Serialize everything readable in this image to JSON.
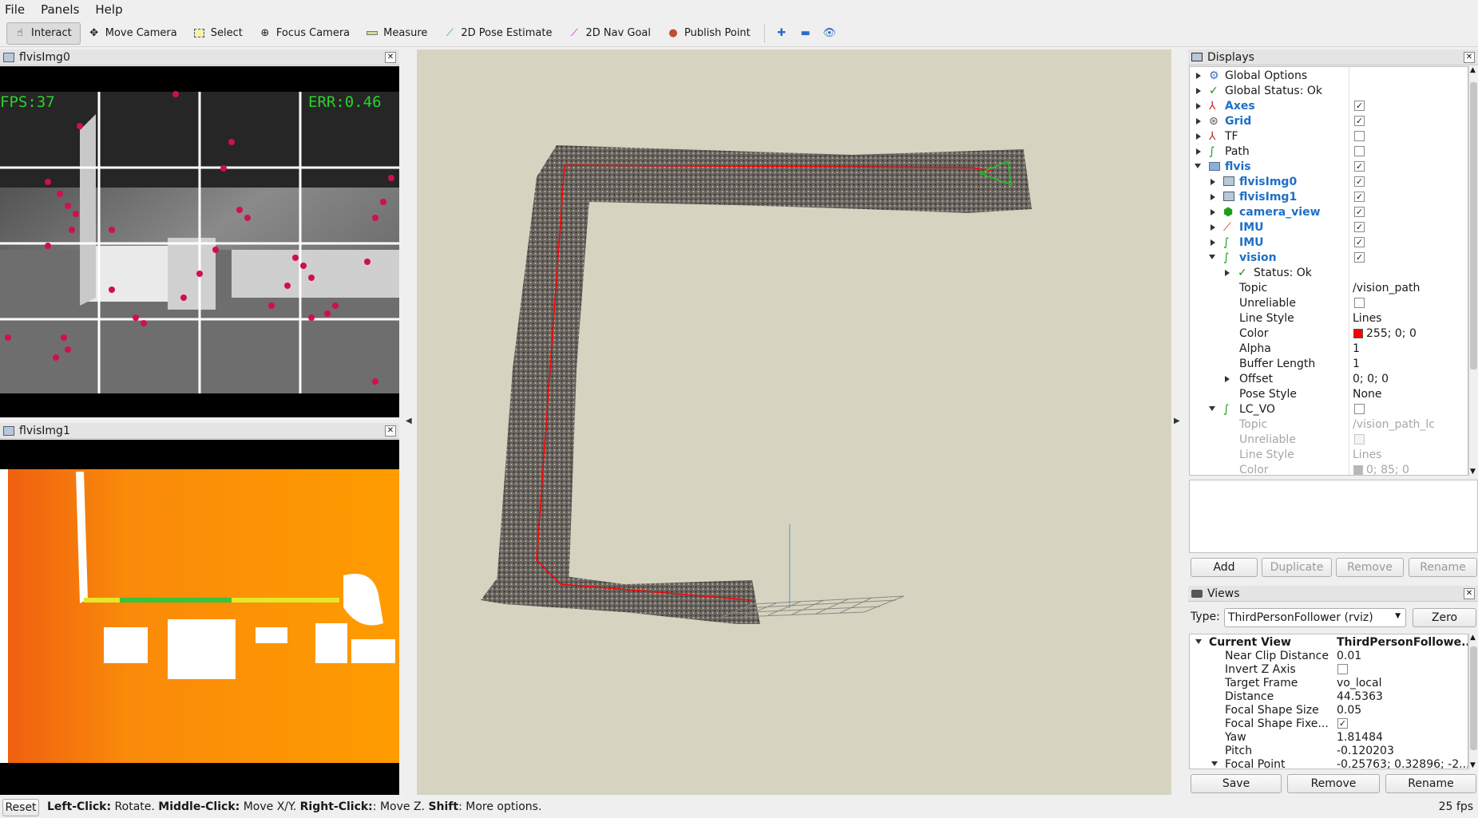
{
  "menu": {
    "file": "File",
    "panels": "Panels",
    "help": "Help"
  },
  "toolbar": {
    "interact": "Interact",
    "move_camera": "Move Camera",
    "select": "Select",
    "focus_camera": "Focus Camera",
    "measure": "Measure",
    "pose_estimate": "2D Pose Estimate",
    "nav_goal": "2D Nav Goal",
    "publish_point": "Publish Point"
  },
  "image_panels": {
    "img0": {
      "title": "flvisImg0",
      "fps": "FPS:37",
      "err": "ERR:0.46"
    },
    "img1": {
      "title": "flvisImg1"
    }
  },
  "displays": {
    "title": "Displays",
    "rows": [
      {
        "label": "Global Options"
      },
      {
        "label": "Global Status: Ok"
      },
      {
        "label": "Axes",
        "checked": true
      },
      {
        "label": "Grid",
        "checked": true
      },
      {
        "label": "TF",
        "checked": false
      },
      {
        "label": "Path",
        "checked": false
      },
      {
        "label": "flvis",
        "checked": true
      },
      {
        "label": "flvisImg0",
        "checked": true
      },
      {
        "label": "flvisImg1",
        "checked": true
      },
      {
        "label": "camera_view",
        "checked": true
      },
      {
        "label": "IMU",
        "checked": true
      },
      {
        "label": "IMU",
        "checked": true
      },
      {
        "label": "vision",
        "checked": true
      },
      {
        "label": "Status: Ok"
      },
      {
        "label": "Topic",
        "value": "/vision_path"
      },
      {
        "label": "Unreliable",
        "checked": false
      },
      {
        "label": "Line Style",
        "value": "Lines"
      },
      {
        "label": "Color",
        "value": "255; 0; 0"
      },
      {
        "label": "Alpha",
        "value": "1"
      },
      {
        "label": "Buffer Length",
        "value": "1"
      },
      {
        "label": "Offset",
        "value": "0; 0; 0"
      },
      {
        "label": "Pose Style",
        "value": "None"
      },
      {
        "label": "LC_VO",
        "checked": false
      },
      {
        "label": "Topic",
        "value": "/vision_path_lc"
      },
      {
        "label": "Unreliable",
        "checked": false
      },
      {
        "label": "Line Style",
        "value": "Lines"
      },
      {
        "label": "Color",
        "value": "0; 85; 0"
      }
    ],
    "buttons": {
      "add": "Add",
      "duplicate": "Duplicate",
      "remove": "Remove",
      "rename": "Rename"
    }
  },
  "views": {
    "title": "Views",
    "type_label": "Type:",
    "type_value": "ThirdPersonFollower (rviz)",
    "zero": "Zero",
    "current_view": "Current View",
    "current_value": "ThirdPersonFollowe...",
    "props": [
      {
        "label": "Near Clip Distance",
        "value": "0.01"
      },
      {
        "label": "Invert Z Axis",
        "checked": false
      },
      {
        "label": "Target Frame",
        "value": "vo_local"
      },
      {
        "label": "Distance",
        "value": "44.5363"
      },
      {
        "label": "Focal Shape Size",
        "value": "0.05"
      },
      {
        "label": "Focal Shape Fixe...",
        "checked": true
      },
      {
        "label": "Yaw",
        "value": "1.81484"
      },
      {
        "label": "Pitch",
        "value": "-0.120203"
      },
      {
        "label": "Focal Point",
        "value": "-0.25763; 0.32896; -2...."
      }
    ],
    "buttons": {
      "save": "Save",
      "remove": "Remove",
      "rename": "Rename"
    }
  },
  "status": {
    "reset": "Reset",
    "left_click": "Left-Click:",
    "rotate": " Rotate. ",
    "middle_click": "Middle-Click:",
    "movexy": " Move X/Y. ",
    "right_click": "Right-Click:",
    "movez": ": Move Z. ",
    "shift": "Shift",
    "more": ": More options.",
    "fps": "25 fps"
  },
  "colors": {
    "path": "#ff0000",
    "lc_vo": "#005500",
    "viewport_bg": "#d6d4c1",
    "accent": "#1e6fc7"
  }
}
